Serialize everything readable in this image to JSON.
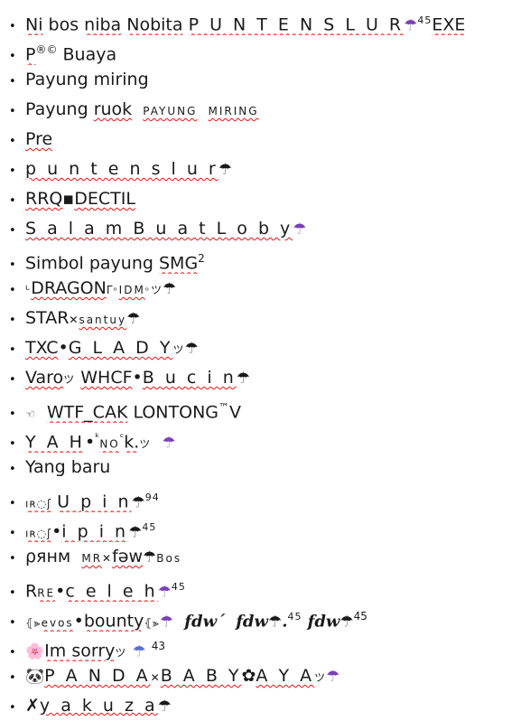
{
  "document": {
    "title": "Nickname list",
    "bullet_glyph": "•",
    "spellcheck_underline_color": "#ee1111",
    "text_color": "#1a1a1a",
    "purple_umbrella_color": "#7b3fb5",
    "pink_flower_color": "#ef6a9e",
    "blue_umbrella_color": "#5b6fd6"
  },
  "list": {
    "items": [
      {
        "id": 1,
        "text": "Ni bos niba Nobita P U N T E N S L U R ☂⁴⁵EXE"
      },
      {
        "id": 2,
        "text": "P®© Buaya"
      },
      {
        "id": 3,
        "text": "Payung miring"
      },
      {
        "id": 4,
        "text": "Payung ruok ᴘᴀʏᴜɴɢ ᴍɪʀɪɴɢ"
      },
      {
        "id": 5,
        "text": "Pre"
      },
      {
        "id": 6,
        "text": "p u n t e n s l u r ☂"
      },
      {
        "id": 7,
        "text": "RRQ▪DECTIL"
      },
      {
        "id": 8,
        "text": "S a l a m B u a t L o b y ☂"
      },
      {
        "id": 9,
        "text": "Simbol payung SMG²"
      },
      {
        "id": 10,
        "text": "ᒡDRAGONᒥ ᵒIDMᵒ ツ ☂"
      },
      {
        "id": 11,
        "text": "STAR✕ ˢᵃⁿᵗᵘʸ ☂"
      },
      {
        "id": 12,
        "text": "TXC•G L A D Y ツ ☂"
      },
      {
        "id": 13,
        "text": "Varo ツ WHCF•B u c i n ☂"
      },
      {
        "id": 14,
        "text": "☜ WTF_CAK LONTONG™V"
      },
      {
        "id": 15,
        "text": "Y A H•ᵏNOᶜk. ツ ☂"
      },
      {
        "id": 16,
        "text": "Yang baru"
      },
      {
        "id": 17,
        "text": "ıʀ◌ʃ U p i n ☂⁹⁴"
      },
      {
        "id": 18,
        "text": "ıʀ◌ʃ•i p i n ☂⁴⁵"
      },
      {
        "id": 19,
        "text": "ρянм ᴹᴿ✕fᵊw☂ ᴮᵒˢ"
      },
      {
        "id": 20,
        "text": "Rᴿᴱ•c e l e h ☂ ⁴⁵"
      },
      {
        "id": 21,
        "text": "⦃⫸✕ ᵉᵛᵒˢ•bͯoͯuͯnͯtͯyͯ⦃⫸✕ ☂  𝒇𝒅𝒘´  𝒇𝒅𝒘☂.⁴⁵  𝒇𝒅𝒘☂⁴⁵"
      },
      {
        "id": 22,
        "text": "🌸 Im sorry ツ ☂ 43"
      },
      {
        "id": 23,
        "text": "🐼P A N D A ✕ B A B Y ✿ A Y A ツ ☂"
      },
      {
        "id": 24,
        "text": "✗ y a k u z a ☂"
      }
    ],
    "segments": {
      "r1": {
        "a": "Ni",
        "b": " bos ",
        "c": "niba",
        "d": " ",
        "e": "Nobita",
        "f": " ",
        "g": "P U N T E N S L U R",
        "sup": "45",
        "exe": "EXE"
      },
      "r2": {
        "a": "P",
        "reg": "®©",
        "b": " Buaya"
      },
      "r3": {
        "a": "Payung miring"
      },
      "r4": {
        "a": "Payung ",
        "b": "ruok",
        "c": "PAYUNG",
        "d": "MIRING"
      },
      "r5": {
        "a": "Pre"
      },
      "r6": {
        "a": "p u n t e n s l u r"
      },
      "r7": {
        "a": "RRQ",
        "sq": "▪",
        "b": "DECTIL"
      },
      "r8": {
        "a": "S a l a m B u a t L o b y"
      },
      "r9": {
        "a": "Simbol payung ",
        "b": "SMG",
        "sup": "2"
      },
      "r10": {
        "pre": "ᒡ",
        "a": "DRAGON",
        "post": "ᒥ",
        "b": "ᵒ",
        "c": "IDM",
        "d": "ᵒ",
        "tsu": "ツ"
      },
      "r11": {
        "a": "STAR",
        "x": "✕",
        "b": "santuy"
      },
      "r12": {
        "a": "TXC",
        "dot": "•",
        "b": "G L A D Y",
        "tsu": "ツ"
      },
      "r13": {
        "a": "Varo",
        "tsu": "ツ",
        "b": "WHCF",
        "dot": "•",
        "c": "B u c i n"
      },
      "r14": {
        "hand": "☜",
        "a": "WTF_CAK",
        "b": " LONTONG",
        "tm": "™",
        "v": "V"
      },
      "r15": {
        "a": "Y A H",
        "dot": "•",
        "k": "ᵏ",
        "b": "NO",
        "c": "ᶜ",
        "d": "k.",
        "tsu": "ツ"
      },
      "r16": {
        "a": "Yang baru"
      },
      "r17": {
        "pre": "ıʀ◌ʃ",
        "a": "U p i n",
        "sup": "94"
      },
      "r18": {
        "pre": "ıʀ◌ʃ",
        "dot": "•",
        "a": "i p i n",
        "sup": "45"
      },
      "r19": {
        "a": "ρянм",
        "mr": "MR",
        "x": "✕",
        "b": "fəw",
        "bos": "Bos"
      },
      "r20": {
        "a": "R",
        "re": "RE",
        "dot": "•",
        "b": "c e l e h",
        "sup": "45"
      },
      "r21": {
        "arrow1": "⦃⫸",
        "evos": "evos",
        "dot": "•",
        "bounty": "bounty",
        "arrow2": "⦃⫸",
        "f1": "fdw",
        "acc": "´",
        "f2": "fdw",
        "p": ".",
        "sup1": "45",
        "f3": "fdw",
        "sup2": "45"
      },
      "r22": {
        "flower": "🌸",
        "a": "Im sorry",
        "tsu": "ツ",
        "num": "43"
      },
      "r23": {
        "panda": "🐼",
        "a": "P A N D A",
        "x": "✕",
        "b": "B A B Y",
        "flower": "✿",
        "c": "A Y A",
        "tsu": "ツ"
      },
      "r24": {
        "x": "✗",
        "a": "y a k u z a"
      }
    }
  }
}
